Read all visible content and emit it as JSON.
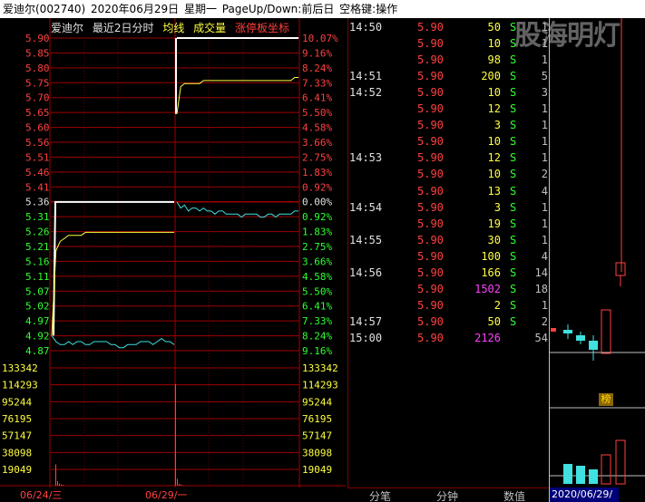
{
  "title_bar": {
    "stock": "爱迪尔(002740)",
    "date": "2020年06月29日",
    "weekday": "星期一",
    "hint": "PageUp/Down:前后日",
    "hint2": "空格键:操作"
  },
  "chart_header": {
    "name": "爱迪尔",
    "period": "最近2日分时",
    "avg_line": "均线",
    "volume": "成交量",
    "limit_axis": "涨停板坐标"
  },
  "colors": {
    "up": "#ff4040",
    "down": "#30ff30",
    "avg": "#ffff40",
    "price": "#40e0e0",
    "grid": "#a00000",
    "purple": "#ff40ff"
  },
  "chart_data": {
    "type": "line",
    "price_ticks": [
      "5.90",
      "5.85",
      "5.80",
      "5.75",
      "5.70",
      "5.65",
      "5.60",
      "5.56",
      "5.51",
      "5.46",
      "5.41",
      "5.36",
      "5.31",
      "5.26",
      "5.21",
      "5.16",
      "5.11",
      "5.07",
      "5.02",
      "4.97",
      "4.92",
      "4.87"
    ],
    "pct_ticks": [
      "10.07%",
      "9.16%",
      "8.24%",
      "7.33%",
      "6.41%",
      "5.50%",
      "4.58%",
      "3.66%",
      "2.75%",
      "1.83%",
      "0.92%",
      "0.00%",
      "0.92%",
      "1.83%",
      "2.75%",
      "3.66%",
      "4.58%",
      "5.50%",
      "6.41%",
      "7.33%",
      "8.24%",
      "9.16%"
    ],
    "vol_ticks": [
      "133342",
      "114293",
      "95244",
      "76195",
      "57147",
      "38098",
      "19049"
    ],
    "ylim": [
      4.87,
      5.9
    ],
    "prev_close": 5.36,
    "day1": {
      "price": [
        4.92,
        4.9,
        4.89,
        4.89,
        4.9,
        4.89,
        4.9,
        4.9,
        4.89,
        4.89,
        4.9,
        4.9,
        4.9,
        4.9,
        4.89,
        4.89,
        4.88,
        4.88,
        4.89,
        4.89,
        4.89,
        4.9,
        4.9,
        4.9,
        4.89,
        4.9,
        4.91,
        4.9,
        4.9,
        4.89
      ],
      "avg": [
        4.92,
        5.2,
        5.23,
        5.24,
        5.25,
        5.25,
        5.25,
        5.25,
        5.26,
        5.26,
        5.26,
        5.26,
        5.26,
        5.26,
        5.26,
        5.26,
        5.26,
        5.26,
        5.26,
        5.26,
        5.26,
        5.26,
        5.26,
        5.26,
        5.26,
        5.26,
        5.26,
        5.26,
        5.26,
        5.26
      ],
      "limit": 5.36
    },
    "day2": {
      "price": [
        5.36,
        5.34,
        5.35,
        5.33,
        5.34,
        5.34,
        5.33,
        5.34,
        5.33,
        5.33,
        5.32,
        5.33,
        5.33,
        5.32,
        5.32,
        5.32,
        5.32,
        5.31,
        5.32,
        5.32,
        5.32,
        5.32,
        5.31,
        5.31,
        5.32,
        5.32,
        5.31,
        5.32,
        5.32,
        5.32,
        5.32,
        5.33,
        5.33
      ],
      "avg": [
        5.65,
        5.74,
        5.75,
        5.75,
        5.75,
        5.75,
        5.75,
        5.76,
        5.76,
        5.76,
        5.76,
        5.76,
        5.76,
        5.76,
        5.76,
        5.76,
        5.76,
        5.76,
        5.76,
        5.76,
        5.76,
        5.76,
        5.76,
        5.76,
        5.76,
        5.76,
        5.76,
        5.76,
        5.76,
        5.76,
        5.76,
        5.77,
        5.77
      ],
      "limit": 5.9
    },
    "volume": {
      "day1": [
        28000,
        6000,
        3000,
        1500,
        1000
      ],
      "day2": [
        133342,
        9000,
        2500,
        1500,
        800
      ]
    },
    "dates": [
      "06/24/三",
      "06/29/一"
    ]
  },
  "trades": [
    {
      "time": "14:50",
      "price": "5.90",
      "vol": "50",
      "side": "S",
      "cnt": "1",
      "volColor": "#ffff40"
    },
    {
      "time": "",
      "price": "5.90",
      "vol": "10",
      "side": "S",
      "cnt": "1",
      "volColor": "#ffff40"
    },
    {
      "time": "",
      "price": "5.90",
      "vol": "98",
      "side": "S",
      "cnt": "1",
      "volColor": "#ffff40"
    },
    {
      "time": "14:51",
      "price": "5.90",
      "vol": "200",
      "side": "S",
      "cnt": "5",
      "volColor": "#ffff40"
    },
    {
      "time": "14:52",
      "price": "5.90",
      "vol": "10",
      "side": "S",
      "cnt": "3",
      "volColor": "#ffff40"
    },
    {
      "time": "",
      "price": "5.90",
      "vol": "12",
      "side": "S",
      "cnt": "1",
      "volColor": "#ffff40"
    },
    {
      "time": "",
      "price": "5.90",
      "vol": "3",
      "side": "S",
      "cnt": "1",
      "volColor": "#ffff40"
    },
    {
      "time": "",
      "price": "5.90",
      "vol": "10",
      "side": "S",
      "cnt": "1",
      "volColor": "#ffff40"
    },
    {
      "time": "14:53",
      "price": "5.90",
      "vol": "12",
      "side": "S",
      "cnt": "1",
      "volColor": "#ffff40"
    },
    {
      "time": "",
      "price": "5.90",
      "vol": "10",
      "side": "S",
      "cnt": "2",
      "volColor": "#ffff40"
    },
    {
      "time": "",
      "price": "5.90",
      "vol": "13",
      "side": "S",
      "cnt": "4",
      "volColor": "#ffff40"
    },
    {
      "time": "14:54",
      "price": "5.90",
      "vol": "3",
      "side": "S",
      "cnt": "1",
      "volColor": "#ffff40"
    },
    {
      "time": "",
      "price": "5.90",
      "vol": "19",
      "side": "S",
      "cnt": "1",
      "volColor": "#ffff40"
    },
    {
      "time": "14:55",
      "price": "5.90",
      "vol": "30",
      "side": "S",
      "cnt": "1",
      "volColor": "#ffff40"
    },
    {
      "time": "",
      "price": "5.90",
      "vol": "100",
      "side": "S",
      "cnt": "4",
      "volColor": "#ffff40"
    },
    {
      "time": "14:56",
      "price": "5.90",
      "vol": "166",
      "side": "S",
      "cnt": "14",
      "volColor": "#ffff40"
    },
    {
      "time": "",
      "price": "5.90",
      "vol": "1502",
      "side": "S",
      "cnt": "18",
      "volColor": "#ff40ff"
    },
    {
      "time": "",
      "price": "5.90",
      "vol": "2",
      "side": "S",
      "cnt": "1",
      "volColor": "#ffff40"
    },
    {
      "time": "14:57",
      "price": "5.90",
      "vol": "50",
      "side": "S",
      "cnt": "2",
      "volColor": "#ffff40"
    },
    {
      "time": "15:00",
      "price": "5.90",
      "vol": "2126",
      "side": "",
      "cnt": "54",
      "volColor": "#ff40ff"
    }
  ],
  "tabs": [
    "分笔",
    "分钟",
    "数值"
  ],
  "k_panel": {
    "date": "2020/06/29/一",
    "badge": "榜",
    "watermark": "股海明灯"
  }
}
